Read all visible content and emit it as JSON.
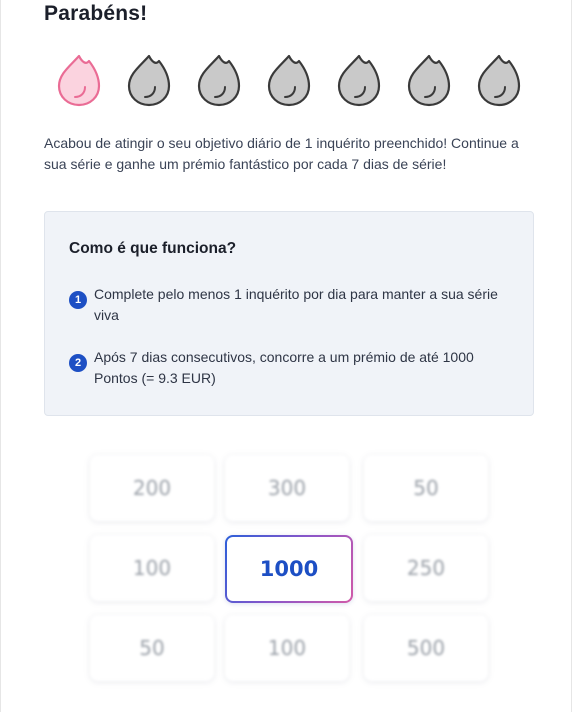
{
  "title": "Parabéns!",
  "streak": {
    "days": [
      {
        "state": "active",
        "color": "#fbd3df",
        "stroke": "#ea6c95"
      },
      {
        "state": "inactive",
        "color": "#c9c9c9",
        "stroke": "#3a3a3a"
      },
      {
        "state": "inactive",
        "color": "#c9c9c9",
        "stroke": "#3a3a3a"
      },
      {
        "state": "inactive",
        "color": "#c9c9c9",
        "stroke": "#3a3a3a"
      },
      {
        "state": "inactive",
        "color": "#c9c9c9",
        "stroke": "#3a3a3a"
      },
      {
        "state": "inactive",
        "color": "#c9c9c9",
        "stroke": "#3a3a3a"
      },
      {
        "state": "inactive",
        "color": "#c9c9c9",
        "stroke": "#3a3a3a"
      }
    ],
    "icon": "flame-icon"
  },
  "description": "Acabou de atingir o seu objetivo diário de 1 inquérito preenchido! Continue a sua série e ganhe um prémio fantástico por cada 7 dias de série!",
  "how": {
    "title": "Como é que funciona?",
    "steps": [
      {
        "number": "1",
        "text": "Complete pelo menos 1 inquérito por dia para manter a sua série viva"
      },
      {
        "number": "2",
        "text": "Após 7 dias consecutivos, concorre a um prémio de até 1000 Pontos (= 9.3 EUR)"
      }
    ]
  },
  "prizes": {
    "tiles": [
      "200",
      "300",
      "50",
      "100",
      "1000",
      "250",
      "50",
      "100",
      "500"
    ],
    "selected_index": 4,
    "accent": "#1d4fc4"
  }
}
